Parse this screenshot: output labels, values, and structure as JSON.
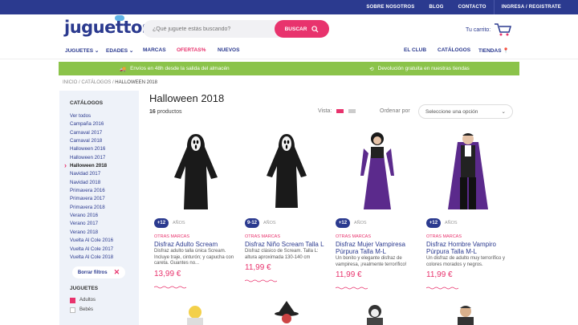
{
  "topbar": {
    "links": [
      "SOBRE NOSOTROS",
      "BLOG",
      "CONTACTO",
      "INGRESA / REGISTRATE"
    ]
  },
  "header": {
    "logo": "juguettos",
    "search_placeholder": "¿Qué juguete estás buscando?",
    "search_button": "BUSCAR",
    "cart_label": "Tu carrito:"
  },
  "nav": {
    "juguetes": "JUGUETES",
    "edades": "EDADES",
    "marcas": "MARCAS",
    "ofertas": "OFERTAS%",
    "nuevos": "NUEVOS",
    "club": "EL CLUB",
    "catalogos": "CATÁLOGOS",
    "tiendas": "TIENDAS"
  },
  "promo": {
    "left": "Envíos en 48h desde la salida del almacén",
    "right": "Devolución gratuita en nuestras tiendas"
  },
  "breadcrumb": {
    "inicio": "INICIO",
    "sep": "/",
    "catalogos": "CATÁLOGOS",
    "current": "HALLOWEEN 2018"
  },
  "sidebar": {
    "title": "CATÁLOGOS",
    "categories": [
      "Ver todos",
      "Campaña 2016",
      "Carnaval 2017",
      "Carnaval 2018",
      "Halloween 2016",
      "Halloween 2017",
      "Halloween 2018",
      "Navidad 2017",
      "Navidad 2018",
      "Primavera 2016",
      "Primavera 2017",
      "Primavera 2018",
      "Verano 2016",
      "Verano 2017",
      "Verano 2018",
      "Vuelta Al Cole 2016",
      "Vuelta Al Cole 2017",
      "Vuelta Al Cole 2018"
    ],
    "active_index": 6,
    "clear_label": "Borrar filtros",
    "filter_title": "JUGUETES",
    "filters": [
      "Adultos",
      "Bebés"
    ]
  },
  "main": {
    "title": "Halloween 2018",
    "count_number": "16",
    "count_label": "productos",
    "vista": "Vista:",
    "order": "Ordenar por",
    "select": "Seleccione una opción"
  },
  "products": [
    {
      "age": "+12",
      "anos": "AÑOS",
      "brand": "OTRAS MARCAS",
      "name": "Disfraz Adulto Scream",
      "desc": "Disfraz adulto talla única Scream. Incluye traje, cinturón; y capucha con careta. Guantes no...",
      "price": "13,99 €"
    },
    {
      "age": "9-12",
      "anos": "AÑOS",
      "brand": "OTRAS MARCAS",
      "name": "Disfraz Niño Scream Talla L",
      "desc": "Disfraz clásico de Scream. Talla L: altura aproximada 130-140 cm",
      "price": "11,99 €"
    },
    {
      "age": "+12",
      "anos": "AÑOS",
      "brand": "OTRAS MARCAS",
      "name": "Disfraz Mujer Vampiresa Púrpura Talla M-L",
      "desc": "Un bonito y elegante disfraz de vampiresa, ¡realmente terrorífico!",
      "price": "11,99 €"
    },
    {
      "age": "+12",
      "anos": "AÑOS",
      "brand": "OTRAS MARCAS",
      "name": "Disfraz Hombre Vampiro Púrpura Talla M-L",
      "desc": "Un disfraz de adulto muy terrorífico y colores morados y negros.",
      "price": "11,99 €"
    }
  ],
  "colors": {
    "brand_blue": "#2b3a8f",
    "pink": "#e8336d",
    "green": "#8bc34a"
  }
}
